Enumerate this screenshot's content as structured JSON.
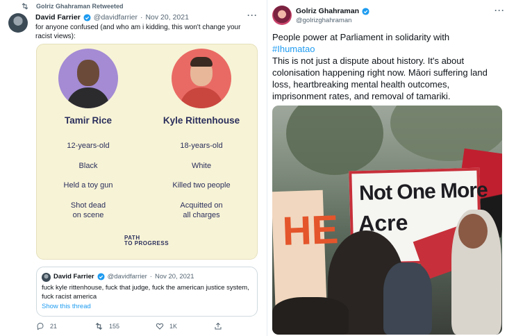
{
  "left_tweet": {
    "retweet_label": "Golriz Ghahraman Retweeted",
    "author_name": "David Farrier",
    "author_handle": "@davidfarrier",
    "separator": "·",
    "date": "Nov 20, 2021",
    "more": "···",
    "text": "for anyone confused (and who am i kidding, this won't change your racist views):",
    "card": {
      "left": {
        "name": "Tamir Rice",
        "items": [
          "12-years-old",
          "Black",
          "Held a toy gun",
          "Shot dead\non scene"
        ]
      },
      "right": {
        "name": "Kyle Rittenhouse",
        "items": [
          "18-years-old",
          "White",
          "Killed two people",
          "Acquitted on\nall charges"
        ]
      },
      "logo_line1": "PATH",
      "logo_line2": "TO PROGRESS"
    },
    "quote": {
      "author_name": "David Farrier",
      "author_handle": "@davidfarrier",
      "separator": "·",
      "date": "Nov 20, 2021",
      "text": "fuck kyle rittenhouse, fuck that judge, fuck the american justice system, fuck racist america",
      "link": "Show this thread"
    },
    "actions": {
      "replies": "21",
      "retweets": "155",
      "likes": "1K"
    }
  },
  "right_tweet": {
    "author_name": "Golriz Ghahraman",
    "author_handle": "@golrizghahraman",
    "more": "···",
    "text_line1": "People power at Parliament in solidarity with",
    "hashtag": "#Ihumatao",
    "text_rest": "This is not just a dispute about history. It's about colonisation happening right now. Māori suffering land loss, heartbreaking mental health outcomes, imprisonment rates, and removal of tamariki.",
    "photo": {
      "sign_main_line1": "Not One More",
      "sign_main_line2": "Acre",
      "sign_left": "HE"
    }
  },
  "colors": {
    "link": "#1d9bf0",
    "muted": "#536471",
    "card_bg": "#f7f3d6",
    "card_text": "#2a2e5c"
  }
}
